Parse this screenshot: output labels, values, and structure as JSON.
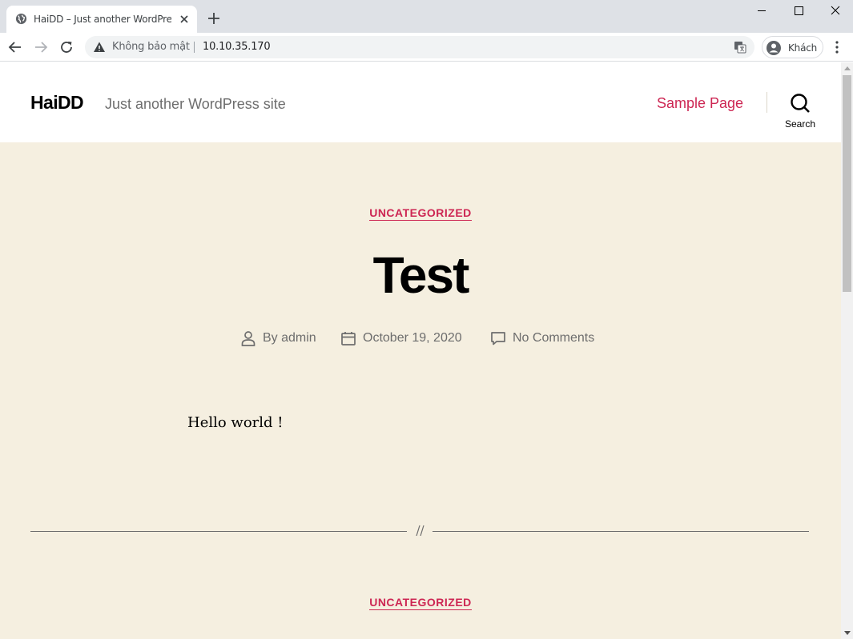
{
  "browser": {
    "tab_title": "HaiDD – Just another WordPress site",
    "security_label": "Không bảo mật",
    "url": "10.10.35.170",
    "profile_label": "Khách"
  },
  "site": {
    "title": "HaiDD",
    "description": "Just another WordPress site",
    "nav": [
      "Sample Page"
    ],
    "search_label": "Search"
  },
  "posts": [
    {
      "category": "UNCATEGORIZED",
      "title": "Test",
      "author": "By admin",
      "date": "October 19, 2020",
      "comments": "No Comments",
      "content": "Hello world !"
    },
    {
      "category": "UNCATEGORIZED"
    }
  ],
  "colors": {
    "accent": "#cd2653",
    "background": "#f5efe0",
    "chrome_tabstrip": "#dee1e6"
  }
}
